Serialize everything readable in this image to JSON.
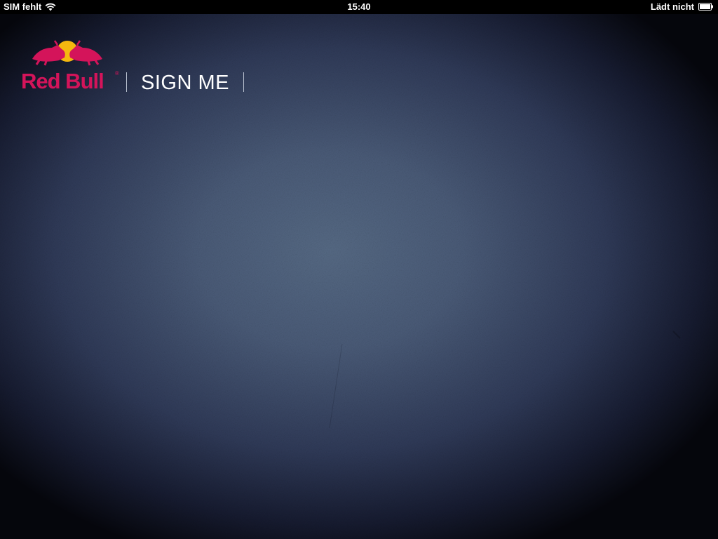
{
  "status_bar": {
    "carrier": "SIM fehlt",
    "time": "15:40",
    "battery_status": "Lädt nicht",
    "wifi_icon": "wifi-icon",
    "battery_icon": "battery-icon"
  },
  "brand": {
    "logo_text": "Red Bull",
    "reg_symbol": "®",
    "app_title": "SIGN ME",
    "logo_icon": "red-bull-bulls-icon",
    "colors": {
      "brand_red": "#d4145a",
      "sun_yellow": "#f5b80f",
      "title_white": "#ffffff"
    }
  },
  "background": {
    "colors": {
      "center": "#566a85",
      "edge": "#05060c"
    }
  }
}
